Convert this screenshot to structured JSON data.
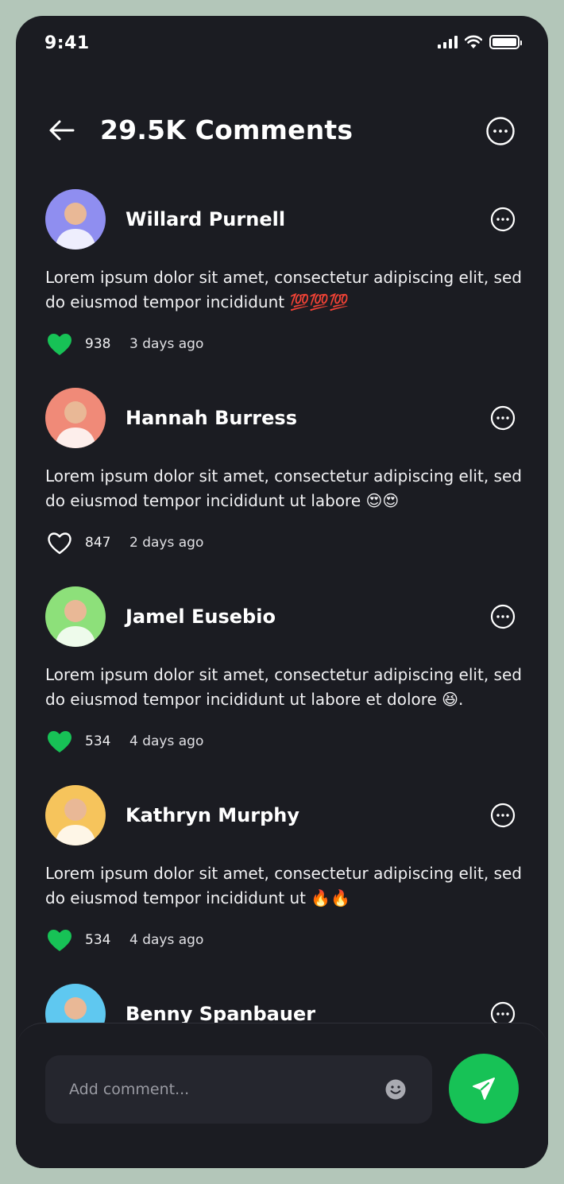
{
  "status_bar": {
    "time": "9:41"
  },
  "header": {
    "title": "29.5K Comments"
  },
  "colors": {
    "accent": "#17C256",
    "background": "#1B1C22",
    "frame": "#B3C6B9"
  },
  "comments": [
    {
      "name": "Willard Purnell",
      "text": "Lorem ipsum dolor sit amet, consectetur adipiscing elit, sed do eiusmod tempor incididunt 💯💯💯",
      "likes": "938",
      "time": "3 days ago",
      "liked": true,
      "avatar_bg": "#8f8ef0"
    },
    {
      "name": "Hannah Burress",
      "text": "Lorem ipsum dolor sit amet, consectetur adipiscing elit, sed do eiusmod tempor incididunt ut labore 😍😍",
      "likes": "847",
      "time": "2 days ago",
      "liked": false,
      "avatar_bg": "#f08a78"
    },
    {
      "name": "Jamel Eusebio",
      "text": "Lorem ipsum dolor sit amet, consectetur adipiscing elit, sed do eiusmod tempor incididunt ut labore et dolore 😆.",
      "likes": "534",
      "time": "4 days ago",
      "liked": true,
      "avatar_bg": "#8de07a"
    },
    {
      "name": "Kathryn Murphy",
      "text": "Lorem ipsum dolor sit amet, consectetur adipiscing elit, sed do eiusmod tempor incididunt ut 🔥🔥",
      "likes": "534",
      "time": "4 days ago",
      "liked": true,
      "avatar_bg": "#f6c45c"
    },
    {
      "name": "Benny Spanbauer",
      "avatar_bg": "#5fc8f0"
    }
  ],
  "composer": {
    "placeholder": "Add comment..."
  }
}
